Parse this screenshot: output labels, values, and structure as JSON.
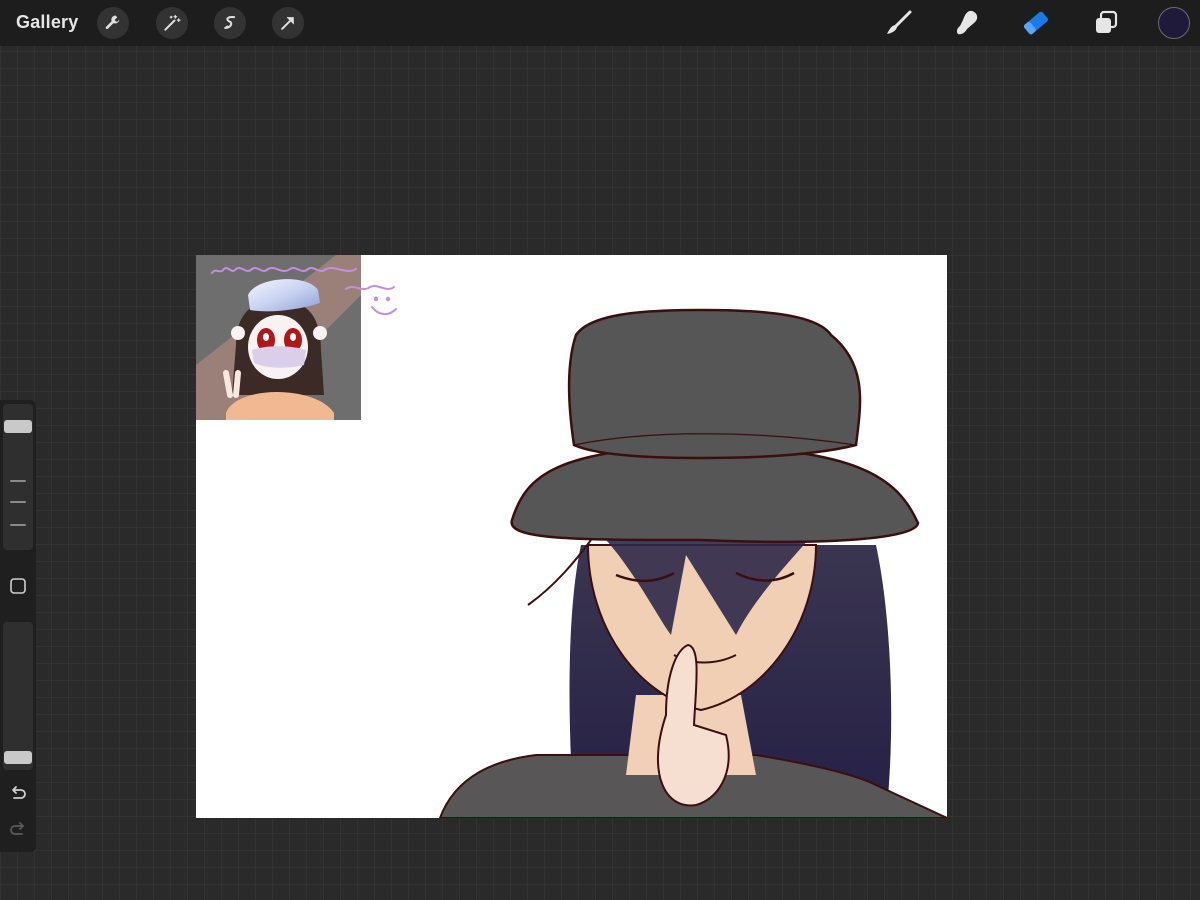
{
  "toolbar": {
    "gallery_label": "Gallery",
    "left_tools": [
      "wrench-icon",
      "magic-wand-icon",
      "selection-icon",
      "transform-arrow-icon"
    ],
    "right_tools": [
      "brush-icon",
      "smudge-icon",
      "eraser-icon",
      "layers-icon"
    ],
    "active_tool": "eraser-icon",
    "active_color": "#1f1a3a",
    "accent_color": "#1a7ae8"
  },
  "sidebar": {
    "brush_size_icon": "brush-size-slider",
    "opacity_icon": "opacity-slider",
    "modify_button": "square-modify-icon",
    "undo_icon": "undo-icon",
    "redo_icon": "redo-icon"
  },
  "canvas": {
    "background": "#ffffff",
    "reference_image": "old-drawing-reference",
    "artwork": "girl-in-bucket-hat-shush-gesture"
  }
}
